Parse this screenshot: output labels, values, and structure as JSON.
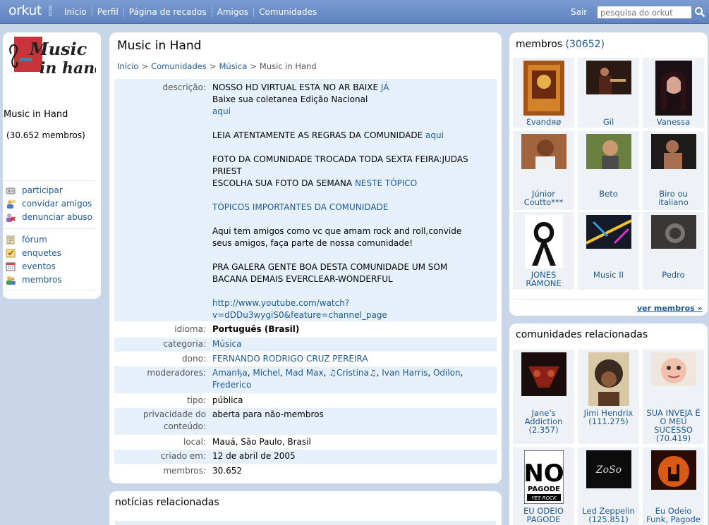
{
  "topbar": {
    "logo": "orkut",
    "beta": "BETA",
    "nav": [
      "Início",
      "Perfil",
      "Página de recados",
      "Amigos",
      "Comunidades"
    ],
    "signout": "Sair",
    "search_placeholder": "pesquisa do orkut"
  },
  "left": {
    "community_name": "Music in Hand",
    "member_count": "(30.652 membros)",
    "menu1": [
      {
        "label": "participar",
        "icon": "join-icon"
      },
      {
        "label": "convidar amigos",
        "icon": "invite-icon"
      },
      {
        "label": "denunciar abuso",
        "icon": "report-icon"
      }
    ],
    "menu2": [
      {
        "label": "fórum",
        "icon": "forum-icon"
      },
      {
        "label": "enquetes",
        "icon": "poll-icon"
      },
      {
        "label": "eventos",
        "icon": "calendar-icon"
      },
      {
        "label": "membros",
        "icon": "members-icon"
      }
    ]
  },
  "main": {
    "title": "Music in Hand",
    "breadcrumb": [
      "Início",
      "Comunidades",
      "Música",
      "Music in Hand"
    ],
    "labels": {
      "descricao": "descrição:",
      "idioma": "idioma:",
      "categoria": "categoria:",
      "dono": "dono:",
      "moderadores": "moderadores:",
      "tipo": "tipo:",
      "privacidade1": "privacidade do",
      "privacidade2": "conteúdo:",
      "local": "local:",
      "criado": "criado em:",
      "membros": "membros:"
    },
    "desc": {
      "l1": "NOSSO HD VIRTUAL ESTA NO AR BAIXE ",
      "l1_link": "JÁ",
      "l2": "Baixe sua coletanea Edição Nacional",
      "l3_link": "aqui",
      "l4": "LEIA ATENTAMENTE AS REGRAS DA COMUNIDADE ",
      "l4_link": "aqui",
      "l5": "FOTO DA COMUNIDADE TROCADA TODA SEXTA FEIRA:JUDAS",
      "l6": "PRIEST",
      "l7": "ESCOLHA SUA FOTO DA SEMANA ",
      "l7_link": "NESTE TÓPICO",
      "l8_link": "TÓPICOS IMPORTANTES DA COMUNIDADE",
      "l9": "Aqui tem amigos como vc que amam rock and roll,convide",
      "l10": "seus amigos, faça parte de nossa comunidade!",
      "l11": "PRA GALERA GENTE BOA DESTA COMUNIDADE UM SOM",
      "l12": "BACANA DEMAIS EVERCLEAR-WONDERFUL",
      "url1": "http://www.youtube.com/watch?",
      "url2": "v=dDDu3wygiS0&feature=channel_page"
    },
    "idioma": "Português (Brasil)",
    "categoria": "Música",
    "dono": "FERNANDO RODRIGO CRUZ PEREIRA",
    "moderadores": [
      "Amanђa",
      "Michel",
      "Mad Max",
      "♫Cristina♫",
      "Ivan Harris",
      "Odilon",
      "Frederico"
    ],
    "tipo": "pública",
    "privacidade": "aberta para não-membros",
    "local": "Mauá, São Paulo, Brasil",
    "criado": "12 de abril de 2005",
    "membros": "30.652"
  },
  "news": {
    "title": "notícias relacionadas"
  },
  "members_box": {
    "title": "membros",
    "count": "(30652)",
    "see_all": "ver membros »",
    "members": [
      {
        "name1": "Ɛvandяø",
        "name2": ""
      },
      {
        "name1": "Gil",
        "name2": ""
      },
      {
        "name1": "Vanessa",
        "name2": ""
      },
      {
        "name1": "Júnior",
        "name2": "Coutto***"
      },
      {
        "name1": "Beto",
        "name2": ""
      },
      {
        "name1": "Biro ou",
        "name2": "italiano"
      },
      {
        "name1": "JONES",
        "name2": "RAMONE"
      },
      {
        "name1": "Music II",
        "name2": ""
      },
      {
        "name1": "Pedro",
        "name2": ""
      }
    ]
  },
  "related_box": {
    "title": "comunidades relacionadas",
    "communities": [
      {
        "l1": "Jane's",
        "l2": "Addiction",
        "l3": "(2.357)",
        "l4": ""
      },
      {
        "l1": "Jimi Hendrix",
        "l2": "(111.275)",
        "l3": "",
        "l4": ""
      },
      {
        "l1": "SUA INVEJA É",
        "l2": "O MEU",
        "l3": "SUCESSO",
        "l4": "(70.419)"
      },
      {
        "l1": "EU ODEIO",
        "l2": "PAGODE",
        "l3": "",
        "l4": ""
      },
      {
        "l1": "Led Zeppelin",
        "l2": "(125.851)",
        "l3": "",
        "l4": ""
      },
      {
        "l1": "Eu Odeio",
        "l2": "Funk, Pagode",
        "l3": "",
        "l4": ""
      }
    ],
    "nopagode_big": "NO",
    "nopagode_mid": "PAGODE",
    "nopagode_small": "YES ROCK",
    "logo_text1": "Music",
    "logo_text2": "in hand"
  }
}
